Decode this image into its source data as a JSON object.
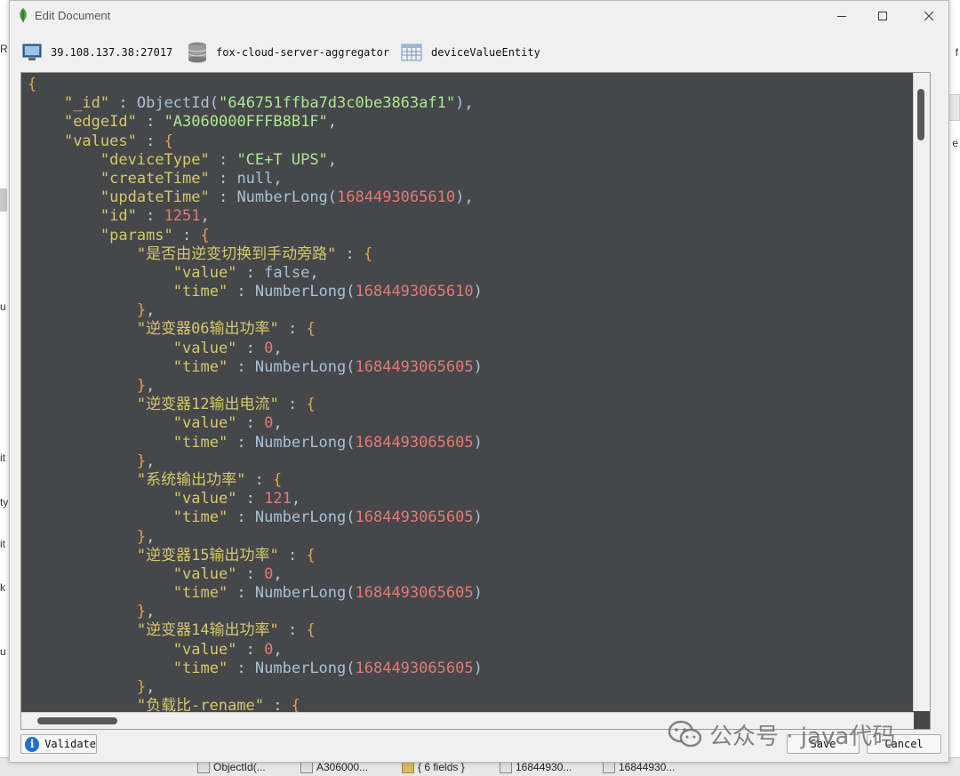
{
  "window": {
    "title": "Edit Document"
  },
  "toolbar": {
    "server": "39.108.137.38:27017",
    "database": "fox-cloud-server-aggregator",
    "collection": "deviceValueEntity"
  },
  "editor_lines": [
    [
      [
        "b",
        "{"
      ]
    ],
    [
      [
        "p",
        "    "
      ],
      [
        "k",
        "\"_id\""
      ],
      [
        "p",
        " : "
      ],
      [
        "f",
        "ObjectId("
      ],
      [
        "s",
        "\"646751ffba7d3c0be3863af1\""
      ],
      [
        "f",
        ")"
      ],
      [
        "p",
        ","
      ]
    ],
    [
      [
        "p",
        "    "
      ],
      [
        "k",
        "\"edgeId\""
      ],
      [
        "p",
        " : "
      ],
      [
        "s",
        "\"A3060000FFFB8B1F\""
      ],
      [
        "p",
        ","
      ]
    ],
    [
      [
        "p",
        "    "
      ],
      [
        "k",
        "\"values\""
      ],
      [
        "p",
        " : "
      ],
      [
        "b",
        "{"
      ]
    ],
    [
      [
        "p",
        "        "
      ],
      [
        "k",
        "\"deviceType\""
      ],
      [
        "p",
        " : "
      ],
      [
        "s",
        "\"CE+T UPS\""
      ],
      [
        "p",
        ","
      ]
    ],
    [
      [
        "p",
        "        "
      ],
      [
        "k",
        "\"createTime\""
      ],
      [
        "p",
        " : "
      ],
      [
        "f",
        "null"
      ],
      [
        "p",
        ","
      ]
    ],
    [
      [
        "p",
        "        "
      ],
      [
        "k",
        "\"updateTime\""
      ],
      [
        "p",
        " : "
      ],
      [
        "f",
        "NumberLong("
      ],
      [
        "n",
        "1684493065610"
      ],
      [
        "f",
        ")"
      ],
      [
        "p",
        ","
      ]
    ],
    [
      [
        "p",
        "        "
      ],
      [
        "k",
        "\"id\""
      ],
      [
        "p",
        " : "
      ],
      [
        "n",
        "1251"
      ],
      [
        "p",
        ","
      ]
    ],
    [
      [
        "p",
        "        "
      ],
      [
        "k",
        "\"params\""
      ],
      [
        "p",
        " : "
      ],
      [
        "b",
        "{"
      ]
    ],
    [
      [
        "p",
        "            "
      ],
      [
        "k",
        "\"是否由逆变切换到手动旁路\""
      ],
      [
        "p",
        " : "
      ],
      [
        "b",
        "{"
      ]
    ],
    [
      [
        "p",
        "                "
      ],
      [
        "k",
        "\"value\""
      ],
      [
        "p",
        " : "
      ],
      [
        "f",
        "false"
      ],
      [
        "p",
        ","
      ]
    ],
    [
      [
        "p",
        "                "
      ],
      [
        "k",
        "\"time\""
      ],
      [
        "p",
        " : "
      ],
      [
        "f",
        "NumberLong("
      ],
      [
        "n",
        "1684493065610"
      ],
      [
        "f",
        ")"
      ]
    ],
    [
      [
        "p",
        "            "
      ],
      [
        "b",
        "}"
      ],
      [
        "p",
        ","
      ]
    ],
    [
      [
        "p",
        "            "
      ],
      [
        "k",
        "\"逆变器06输出功率\""
      ],
      [
        "p",
        " : "
      ],
      [
        "b",
        "{"
      ]
    ],
    [
      [
        "p",
        "                "
      ],
      [
        "k",
        "\"value\""
      ],
      [
        "p",
        " : "
      ],
      [
        "n",
        "0"
      ],
      [
        "p",
        ","
      ]
    ],
    [
      [
        "p",
        "                "
      ],
      [
        "k",
        "\"time\""
      ],
      [
        "p",
        " : "
      ],
      [
        "f",
        "NumberLong("
      ],
      [
        "n",
        "1684493065605"
      ],
      [
        "f",
        ")"
      ]
    ],
    [
      [
        "p",
        "            "
      ],
      [
        "b",
        "}"
      ],
      [
        "p",
        ","
      ]
    ],
    [
      [
        "p",
        "            "
      ],
      [
        "k",
        "\"逆变器12输出电流\""
      ],
      [
        "p",
        " : "
      ],
      [
        "b",
        "{"
      ]
    ],
    [
      [
        "p",
        "                "
      ],
      [
        "k",
        "\"value\""
      ],
      [
        "p",
        " : "
      ],
      [
        "n",
        "0"
      ],
      [
        "p",
        ","
      ]
    ],
    [
      [
        "p",
        "                "
      ],
      [
        "k",
        "\"time\""
      ],
      [
        "p",
        " : "
      ],
      [
        "f",
        "NumberLong("
      ],
      [
        "n",
        "1684493065605"
      ],
      [
        "f",
        ")"
      ]
    ],
    [
      [
        "p",
        "            "
      ],
      [
        "b",
        "}"
      ],
      [
        "p",
        ","
      ]
    ],
    [
      [
        "p",
        "            "
      ],
      [
        "k",
        "\"系统输出功率\""
      ],
      [
        "p",
        " : "
      ],
      [
        "b",
        "{"
      ]
    ],
    [
      [
        "p",
        "                "
      ],
      [
        "k",
        "\"value\""
      ],
      [
        "p",
        " : "
      ],
      [
        "n",
        "121"
      ],
      [
        "p",
        ","
      ]
    ],
    [
      [
        "p",
        "                "
      ],
      [
        "k",
        "\"time\""
      ],
      [
        "p",
        " : "
      ],
      [
        "f",
        "NumberLong("
      ],
      [
        "n",
        "1684493065605"
      ],
      [
        "f",
        ")"
      ]
    ],
    [
      [
        "p",
        "            "
      ],
      [
        "b",
        "}"
      ],
      [
        "p",
        ","
      ]
    ],
    [
      [
        "p",
        "            "
      ],
      [
        "k",
        "\"逆变器15输出功率\""
      ],
      [
        "p",
        " : "
      ],
      [
        "b",
        "{"
      ]
    ],
    [
      [
        "p",
        "                "
      ],
      [
        "k",
        "\"value\""
      ],
      [
        "p",
        " : "
      ],
      [
        "n",
        "0"
      ],
      [
        "p",
        ","
      ]
    ],
    [
      [
        "p",
        "                "
      ],
      [
        "k",
        "\"time\""
      ],
      [
        "p",
        " : "
      ],
      [
        "f",
        "NumberLong("
      ],
      [
        "n",
        "1684493065605"
      ],
      [
        "f",
        ")"
      ]
    ],
    [
      [
        "p",
        "            "
      ],
      [
        "b",
        "}"
      ],
      [
        "p",
        ","
      ]
    ],
    [
      [
        "p",
        "            "
      ],
      [
        "k",
        "\"逆变器14输出功率\""
      ],
      [
        "p",
        " : "
      ],
      [
        "b",
        "{"
      ]
    ],
    [
      [
        "p",
        "                "
      ],
      [
        "k",
        "\"value\""
      ],
      [
        "p",
        " : "
      ],
      [
        "n",
        "0"
      ],
      [
        "p",
        ","
      ]
    ],
    [
      [
        "p",
        "                "
      ],
      [
        "k",
        "\"time\""
      ],
      [
        "p",
        " : "
      ],
      [
        "f",
        "NumberLong("
      ],
      [
        "n",
        "1684493065605"
      ],
      [
        "f",
        ")"
      ]
    ],
    [
      [
        "p",
        "            "
      ],
      [
        "b",
        "}"
      ],
      [
        "p",
        ","
      ]
    ],
    [
      [
        "p",
        "            "
      ],
      [
        "k",
        "\"负载比-rename\""
      ],
      [
        "p",
        " : "
      ],
      [
        "b",
        "{"
      ]
    ]
  ],
  "buttons": {
    "validate": "Validate",
    "save": "Save",
    "cancel": "Cancel"
  },
  "watermark": {
    "text": "公众号 · java代码"
  },
  "background": {
    "left_letters": [
      "R",
      "u",
      "it",
      "ty",
      "it",
      "k",
      "u"
    ],
    "right_letters": [
      "f",
      "e"
    ],
    "bottom_tabs": [
      "ObjectId(...",
      "A306000...",
      "{ 6 fields }",
      "16844930...",
      "16844930..."
    ]
  },
  "colors": {
    "editor_bg": "#45474b",
    "key": "#d6c86a",
    "string": "#ace88f",
    "number": "#e47a72",
    "function": "#a9c1d6"
  }
}
